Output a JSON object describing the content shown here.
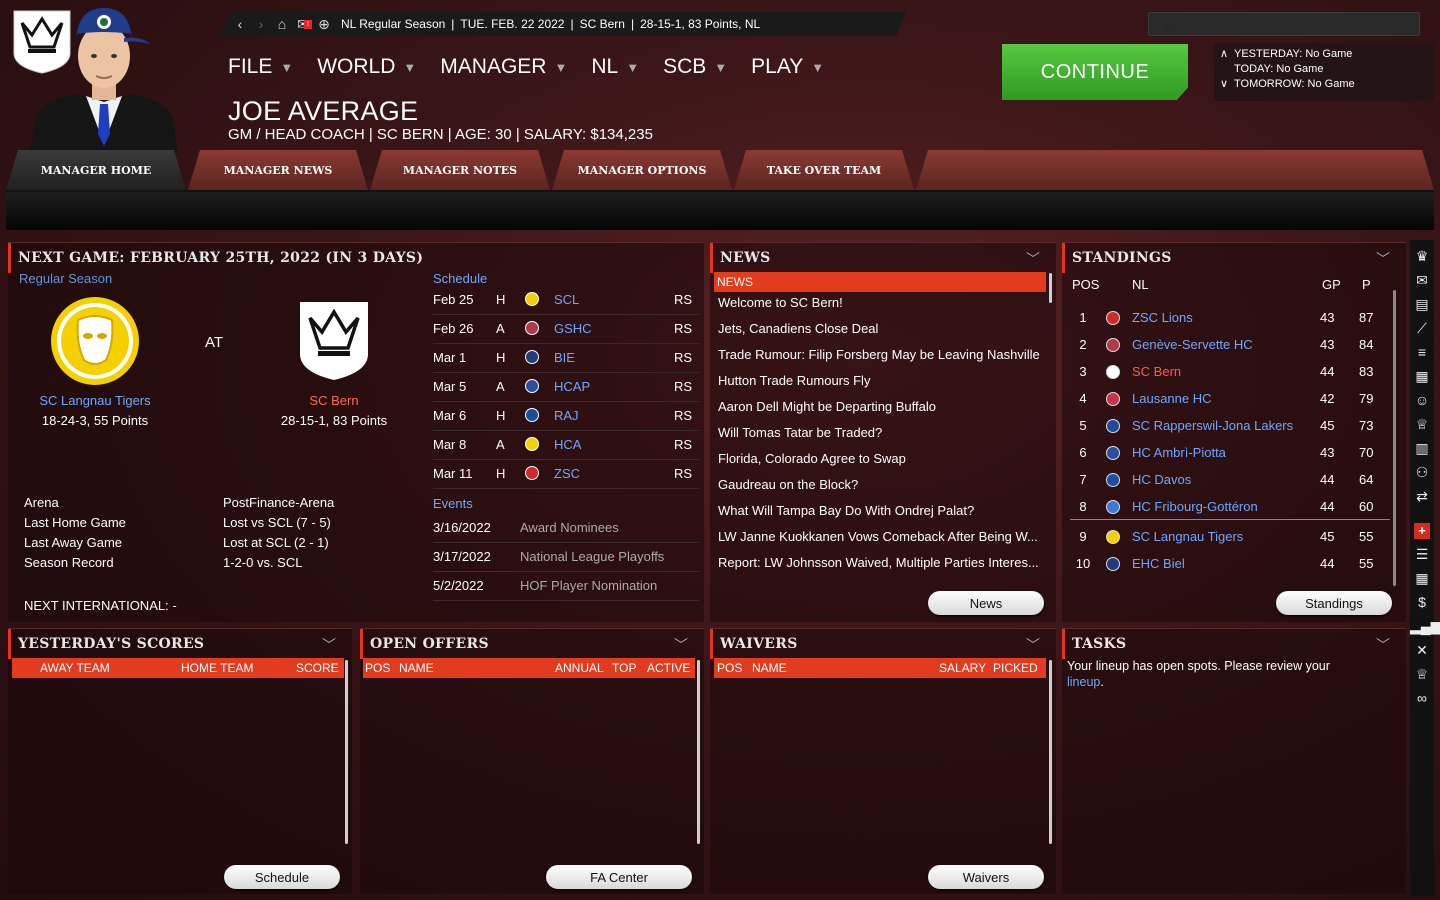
{
  "topbar": {
    "league_season": "NL Regular Season",
    "date": "TUE. FEB. 22 2022",
    "team": "SC Bern",
    "record": "28-15-1, 83 Points, NL",
    "mail_badge": "!"
  },
  "menu": [
    "FILE",
    "WORLD",
    "MANAGER",
    "NL",
    "SCB",
    "PLAY"
  ],
  "manager": {
    "name": "JOE AVERAGE",
    "subtitle": "GM / HEAD COACH | SC BERN | AGE: 30 | SALARY: $134,235"
  },
  "continue_label": "CONTINUE",
  "days": {
    "yesterday": "YESTERDAY: No Game",
    "today": "TODAY: No Game",
    "tomorrow": "TOMORROW: No Game"
  },
  "tabs": [
    "MANAGER HOME",
    "MANAGER NEWS",
    "MANAGER NOTES",
    "MANAGER OPTIONS",
    "TAKE OVER TEAM"
  ],
  "next_game": {
    "title": "NEXT GAME: FEBRUARY 25TH, 2022 (IN 3 DAYS)",
    "season_type": "Regular Season",
    "at": "AT",
    "away_name": "SC Langnau Tigers",
    "away_record": "18-24-3, 55 Points",
    "home_name": "SC Bern",
    "home_record": "28-15-1, 83 Points",
    "details": [
      {
        "label": "Arena",
        "value": "PostFinance-Arena"
      },
      {
        "label": "Last Home Game",
        "value": "Lost vs SCL (7 - 5)"
      },
      {
        "label": "Last Away Game",
        "value": "Lost at SCL (2 - 1)"
      },
      {
        "label": "Season Record",
        "value": "1-2-0 vs. SCL"
      }
    ],
    "international": "NEXT INTERNATIONAL: -",
    "schedule_label": "Schedule",
    "schedule": [
      {
        "date": "Feb 25",
        "ha": "H",
        "team": "SCL",
        "type": "RS",
        "color": "#f5d000"
      },
      {
        "date": "Feb 26",
        "ha": "A",
        "team": "GSHC",
        "type": "RS",
        "color": "#b03a4a"
      },
      {
        "date": "Mar 1",
        "ha": "H",
        "team": "BIE",
        "type": "RS",
        "color": "#1f3d7a"
      },
      {
        "date": "Mar 5",
        "ha": "A",
        "team": "HCAP",
        "type": "RS",
        "color": "#2a4fa0"
      },
      {
        "date": "Mar 6",
        "ha": "H",
        "team": "RAJ",
        "type": "RS",
        "color": "#1b4d9c"
      },
      {
        "date": "Mar 8",
        "ha": "A",
        "team": "HCA",
        "type": "RS",
        "color": "#f5d000"
      },
      {
        "date": "Mar 11",
        "ha": "H",
        "team": "ZSC",
        "type": "RS",
        "color": "#d22a2a"
      }
    ],
    "events_label": "Events",
    "events": [
      {
        "date": "3/16/2022",
        "name": "Award Nominees"
      },
      {
        "date": "3/17/2022",
        "name": "National League Playoffs"
      },
      {
        "date": "5/2/2022",
        "name": "HOF Player Nomination"
      }
    ]
  },
  "news": {
    "title": "NEWS",
    "header": "NEWS",
    "items": [
      "Welcome to SC Bern!",
      "Jets, Canadiens Close Deal",
      "Trade Rumour: Filip Forsberg May be Leaving Nashville",
      "Hutton Trade Rumours Fly",
      "Aaron Dell Might be Departing Buffalo",
      "Will Tomas Tatar be Traded?",
      "Florida, Colorado Agree to Swap",
      "Gaudreau on the Block?",
      "What Will Tampa Bay Do With Ondrej Palat?",
      "LW Janne Kuokkanen Vows Comeback After Being W...",
      "Report: LW Johnsson Waived, Multiple Parties Interes..."
    ],
    "button": "News"
  },
  "standings": {
    "title": "STANDINGS",
    "headers": {
      "pos": "POS",
      "league": "NL",
      "gp": "GP",
      "p": "P"
    },
    "rows": [
      {
        "pos": "1",
        "team": "ZSC Lions",
        "gp": "43",
        "p": "87",
        "color": "#d22a2a"
      },
      {
        "pos": "2",
        "team": "Genève-Servette HC",
        "gp": "43",
        "p": "84",
        "color": "#b03a4a"
      },
      {
        "pos": "3",
        "team": "SC Bern",
        "gp": "44",
        "p": "83",
        "color": "#ffffff"
      },
      {
        "pos": "4",
        "team": "Lausanne HC",
        "gp": "42",
        "p": "79",
        "color": "#c8324a"
      },
      {
        "pos": "5",
        "team": "SC Rapperswil-Jona Lakers",
        "gp": "45",
        "p": "73",
        "color": "#1b4d9c"
      },
      {
        "pos": "6",
        "team": "HC Ambrì-Piotta",
        "gp": "43",
        "p": "70",
        "color": "#2a4fa0"
      },
      {
        "pos": "7",
        "team": "HC Davos",
        "gp": "44",
        "p": "64",
        "color": "#1f4da0"
      },
      {
        "pos": "8",
        "team": "HC Fribourg-Gottéron",
        "gp": "44",
        "p": "60",
        "color": "#3b7bd4"
      },
      {
        "pos": "9",
        "team": "SC Langnau Tigers",
        "gp": "45",
        "p": "55",
        "color": "#f5d000"
      },
      {
        "pos": "10",
        "team": "EHC Biel",
        "gp": "44",
        "p": "55",
        "color": "#1f3d7a"
      }
    ],
    "button": "Standings"
  },
  "scores": {
    "title": "YESTERDAY'S SCORES",
    "cols": [
      "AWAY TEAM",
      "HOME TEAM",
      "SCORE"
    ],
    "button": "Schedule"
  },
  "offers": {
    "title": "OPEN OFFERS",
    "cols": [
      "POS",
      "NAME",
      "ANNUAL",
      "TOP",
      "ACTIVE"
    ],
    "button": "FA Center"
  },
  "waivers": {
    "title": "WAIVERS",
    "cols": [
      "POS",
      "NAME",
      "SALARY",
      "PICKED"
    ],
    "button": "Waivers"
  },
  "tasks": {
    "title": "TASKS",
    "text": "Your lineup has open spots. Please review your",
    "link": "lineup",
    "end": "."
  },
  "colors": {
    "accent": "#e23b1d",
    "continue": "#3fae2c",
    "link": "#6fa6ff"
  }
}
